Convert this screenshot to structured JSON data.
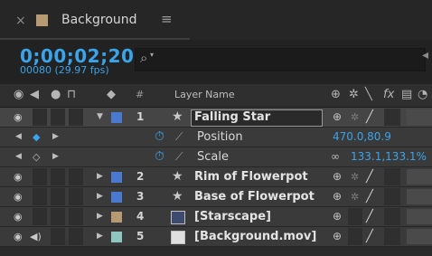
{
  "tab": {
    "close_glyph": "×",
    "title": "Background",
    "menu_glyph": "≡",
    "swatch_color": "#b59a72"
  },
  "info": {
    "timecode": "0;00;02;20",
    "frame_info": "00080 (29.97 fps)",
    "search_placeholder": ""
  },
  "header": {
    "hash": "#",
    "layer_name": "Layer Name",
    "icons": [
      "eye-icon",
      "audio-icon",
      "solo-icon",
      "lock-icon",
      "label-icon",
      "shy-icon",
      "collapse-icon",
      "quality-icon",
      "fx-icon",
      "frame-blend-icon",
      "motion-blur-icon"
    ]
  },
  "layers": [
    {
      "number": "1",
      "name": "Falling Star",
      "color": "#4a7ad0",
      "selected": true,
      "expanded": true,
      "type": "star"
    },
    {
      "number": "2",
      "name": "Rim of Flowerpot",
      "color": "#4a7ad0",
      "type": "star"
    },
    {
      "number": "3",
      "name": "Base of Flowerpot",
      "color": "#4a7ad0",
      "type": "star"
    },
    {
      "number": "4",
      "name": "[Starscape]",
      "color": "#b59a72",
      "type": "image"
    },
    {
      "number": "5",
      "name": "[Background.mov]",
      "color": "#8fc6c0",
      "type": "movie"
    }
  ],
  "properties": [
    {
      "name": "Position",
      "value": "470.0,80.9"
    },
    {
      "name": "Scale",
      "value": "133.1,133.1%",
      "link_glyph": "∞"
    }
  ]
}
